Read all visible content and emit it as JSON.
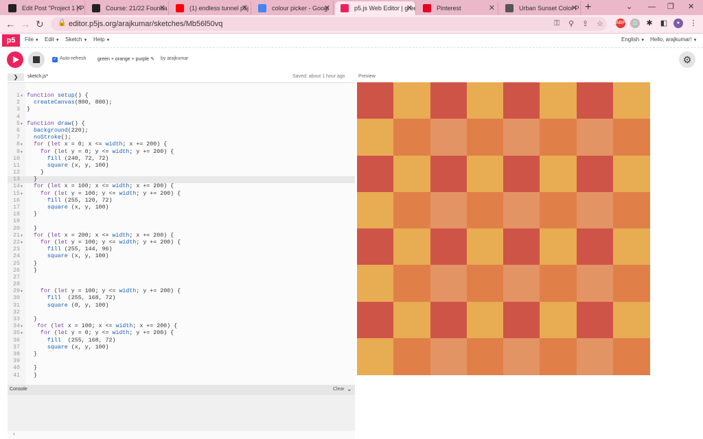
{
  "browser": {
    "tabs": [
      {
        "title": "Edit Post \"Project 1 | P",
        "favicon": "wordpress-icon",
        "color": "#222222"
      },
      {
        "title": "Course: 21/22 Founda",
        "favicon": "moodle-icon",
        "color": "#222222"
      },
      {
        "title": "(1) endless tunnel p5j",
        "favicon": "youtube-icon",
        "color": "#ff0000"
      },
      {
        "title": "colour picker - Googl",
        "favicon": "google-icon",
        "color": "#4285f4"
      },
      {
        "title": "p5.js Web Editor | gree",
        "favicon": "p5-asterisk-icon",
        "color": "#ed225d",
        "active": true
      },
      {
        "title": "Pinterest",
        "favicon": "pinterest-icon",
        "color": "#e60023"
      },
      {
        "title": "Urban Sunset Color P",
        "favicon": "globe-icon",
        "color": "#555555"
      }
    ],
    "url": "editor.p5js.org/arajkumar/sketches/Mb56l50vq"
  },
  "p5": {
    "logo": "p5",
    "menus": [
      "File",
      "Edit",
      "Sketch",
      "Help"
    ],
    "language": "English",
    "greeting": "Hello, arajkumar!",
    "auto_refresh": "Auto-refresh",
    "sketch_name": "green + orange + purple",
    "author": "by arajkumar",
    "filename": "sketch.js",
    "unsaved_marker": "*",
    "saved": "Saved: about 1 hour ago",
    "preview_label": "Preview",
    "console_label": "Console",
    "clear_label": "Clear",
    "prompt": "›"
  },
  "code": [
    "function setup() {",
    "  createCanvas(800, 800);",
    "}",
    "",
    "function draw() {",
    "  background(220);",
    "  noStroke();",
    "  for (let x = 0; x <= width; x += 200) {",
    "    for (let y = 0; y <= width; y += 200) {",
    "      fill (240, 72, 72)",
    "      square (x, y, 100)",
    "    }",
    "  }",
    "  for (let x = 100; x <= width; x += 200) {",
    "    for (let y = 100; y <= width; y += 200) {",
    "      fill (255, 120, 72)",
    "      square (x, y, 100)",
    "  }",
    "",
    "  }",
    "  for (let x = 200; x <= width; x += 200) {",
    "    for (let y = 100; y <= width; y += 200) {",
    "      fill (255, 144, 96)",
    "      square (x, y, 100)",
    "  }",
    "  }",
    "",
    "",
    "    for (let y = 100; y <= width; y += 200) {",
    "      fill  (255, 168, 72)",
    "      square (0, y, 100)",
    "",
    "  }",
    "   for (let x = 100; x <= width; x += 200) {",
    "    for (let y = 0; y <= width; y += 200) {",
    "      fill  (255, 168, 72)",
    "      square (x, y, 100)",
    "  }",
    "",
    "  }",
    "  }"
  ],
  "fold_lines": [
    1,
    5,
    8,
    9,
    14,
    15,
    21,
    22,
    29,
    34,
    35
  ],
  "highlight_line": 13,
  "preview": {
    "grid": 8,
    "colors": {
      "red": "#cf5448",
      "yellow": "#e8ac52",
      "orange": "#e08048",
      "peach": "#e39464"
    },
    "pattern": [
      [
        "red",
        "yellow",
        "red",
        "yellow",
        "red",
        "yellow",
        "red",
        "yellow"
      ],
      [
        "yellow",
        "orange",
        "peach",
        "orange",
        "peach",
        "orange",
        "peach",
        "orange"
      ],
      [
        "red",
        "yellow",
        "red",
        "yellow",
        "red",
        "yellow",
        "red",
        "yellow"
      ],
      [
        "yellow",
        "orange",
        "peach",
        "orange",
        "peach",
        "orange",
        "peach",
        "orange"
      ],
      [
        "red",
        "yellow",
        "red",
        "yellow",
        "red",
        "yellow",
        "red",
        "yellow"
      ],
      [
        "yellow",
        "orange",
        "peach",
        "orange",
        "peach",
        "orange",
        "peach",
        "orange"
      ],
      [
        "red",
        "yellow",
        "red",
        "yellow",
        "red",
        "yellow",
        "red",
        "yellow"
      ],
      [
        "yellow",
        "orange",
        "peach",
        "orange",
        "peach",
        "orange",
        "peach",
        "orange"
      ]
    ]
  }
}
